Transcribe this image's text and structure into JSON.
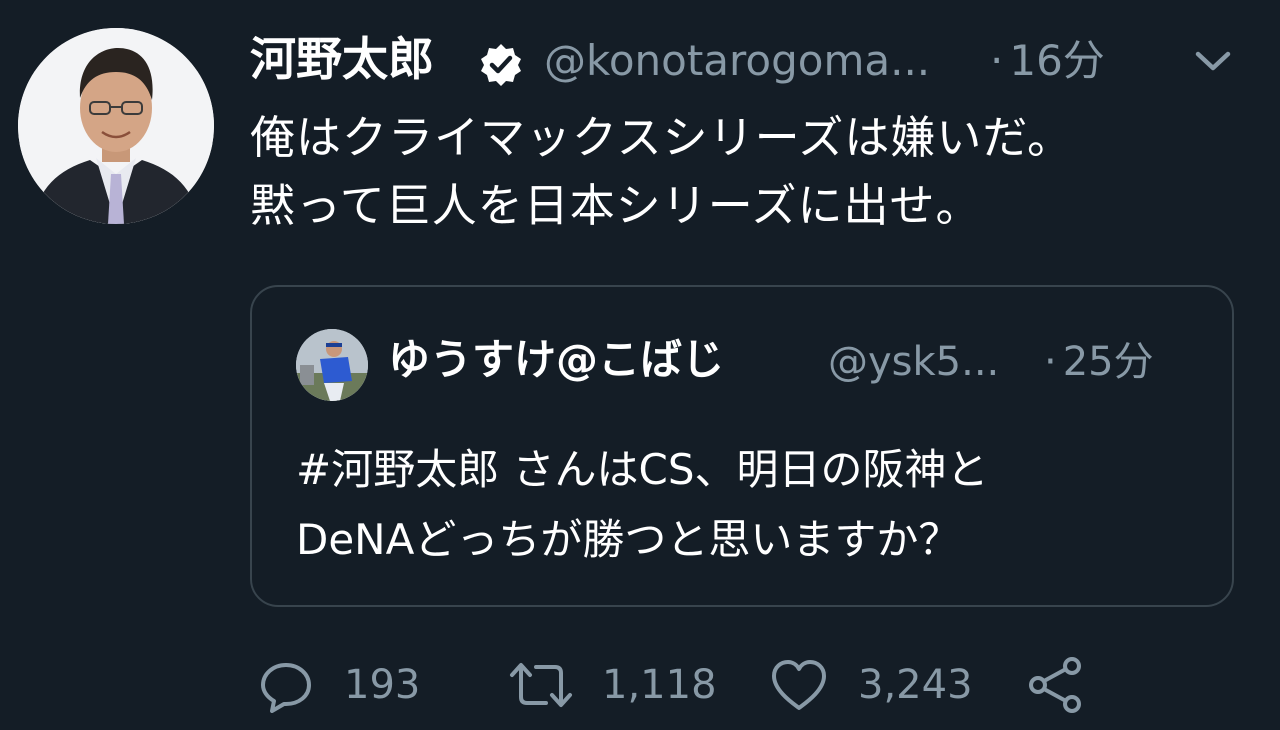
{
  "tweet": {
    "author": {
      "display_name": "河野太郎",
      "handle": "@konotarogoma...",
      "verified": true
    },
    "timestamp": "16分",
    "text_lines": [
      "俺はクライマックスシリーズは嫌いだ。",
      "黙って巨人を日本シリーズに出せ。"
    ]
  },
  "quoted_tweet": {
    "author": {
      "display_name": "ゆうすけ@こばじ",
      "handle": "@ysk5..."
    },
    "timestamp": "25分",
    "text_lines": [
      "#河野太郎 さんはCS、明日の阪神と",
      "DeNAどっちが勝つと思いますか？"
    ]
  },
  "actions": {
    "reply_count": "193",
    "retweet_count": "1,118",
    "like_count": "3,243"
  },
  "icons": {
    "verified": "verified-badge-icon",
    "caret": "chevron-down-icon",
    "reply": "reply-bubble-icon",
    "retweet": "retweet-icon",
    "like": "heart-icon",
    "share": "share-icon"
  },
  "colors": {
    "background": "#141d26",
    "primary_text": "#ffffff",
    "secondary_text": "#8899a6",
    "border": "#38444d"
  },
  "separator": "·"
}
